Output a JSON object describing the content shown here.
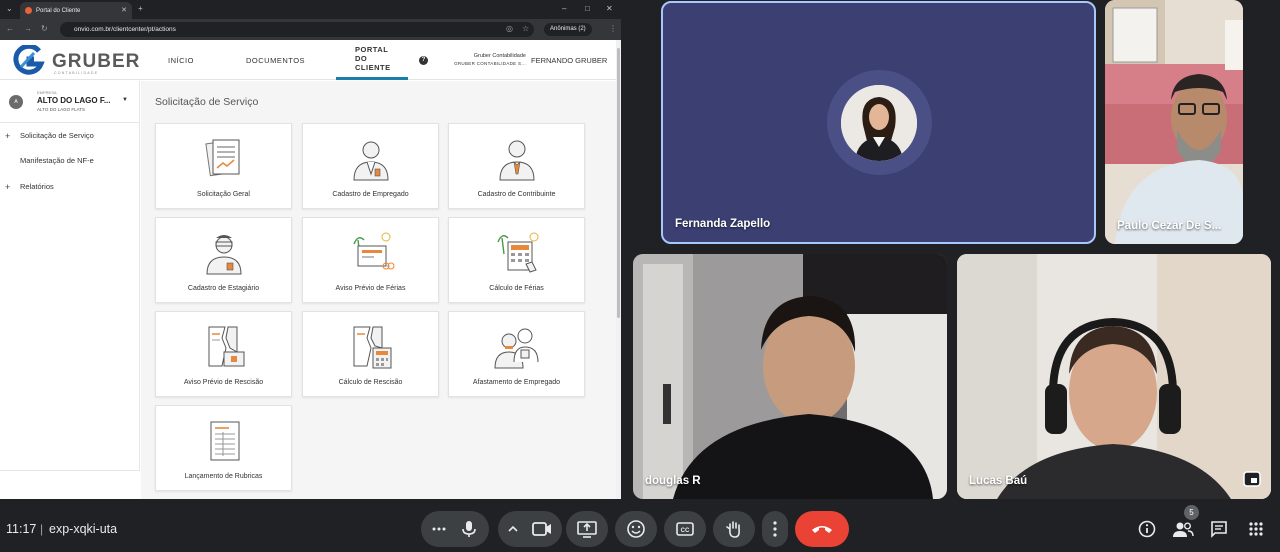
{
  "browser": {
    "tab_title": "Portal do Cliente",
    "url": "onvio.com.br/clientcenter/pt/actions",
    "incognito_label": "Anônimas (2)"
  },
  "app": {
    "logo_text": "GRUBER",
    "logo_sub": "CONTABILIDADE",
    "brand_color": "#1a5aa8",
    "accent_color": "#1a7fa8",
    "nav": {
      "inicio": "INÍCIO",
      "documentos": "DOCUMENTOS",
      "portal_line1": "PORTAL",
      "portal_line2": "DO",
      "portal_line3": "CLIENTE"
    },
    "help_glyph": "?",
    "account_line1": "Gruber Contabilidade",
    "account_line2": "GRUBER CONTABILIDADE S...",
    "user_name": "FERNANDO GRUBER"
  },
  "sidebar": {
    "company_label": "EMPRESA",
    "company_initial": "A",
    "company_name": "ALTO DO LAGO F...",
    "company_subname": "ALTO DO LAGO FLATS",
    "items": [
      {
        "label": "Solicitação de Serviço",
        "expand": "+"
      },
      {
        "label": "Manifestação de NF-e",
        "expand": ""
      },
      {
        "label": "Relatórios",
        "expand": "+"
      }
    ]
  },
  "main": {
    "title": "Solicitação de Serviço",
    "cards": [
      {
        "label": "Solicitação Geral",
        "icon": "general-request-icon"
      },
      {
        "label": "Cadastro de Empregado",
        "icon": "employee-icon"
      },
      {
        "label": "Cadastro de Contribuinte",
        "icon": "taxpayer-icon"
      },
      {
        "label": "Cadastro de Estagiário",
        "icon": "intern-icon"
      },
      {
        "label": "Aviso Prévio de Férias",
        "icon": "vacation-notice-icon"
      },
      {
        "label": "Cálculo de Férias",
        "icon": "vacation-calc-icon"
      },
      {
        "label": "Aviso Prévio de Rescisão",
        "icon": "termination-notice-icon"
      },
      {
        "label": "Cálculo de Rescisão",
        "icon": "termination-calc-icon"
      },
      {
        "label": "Afastamento de Empregado",
        "icon": "leave-icon"
      },
      {
        "label": "Lançamento de Rubricas",
        "icon": "payroll-items-icon"
      }
    ]
  },
  "meet": {
    "participants": {
      "fernanda": "Fernanda Zapello",
      "paulo": "Paulo Cezar De S...",
      "douglas": "douglas R",
      "lucas": "Lucas Baú"
    },
    "time": "11:17",
    "separator": "|",
    "meeting_code": "exp-xqki-uta",
    "participant_count": "5",
    "end_call_color": "#ea4335"
  }
}
